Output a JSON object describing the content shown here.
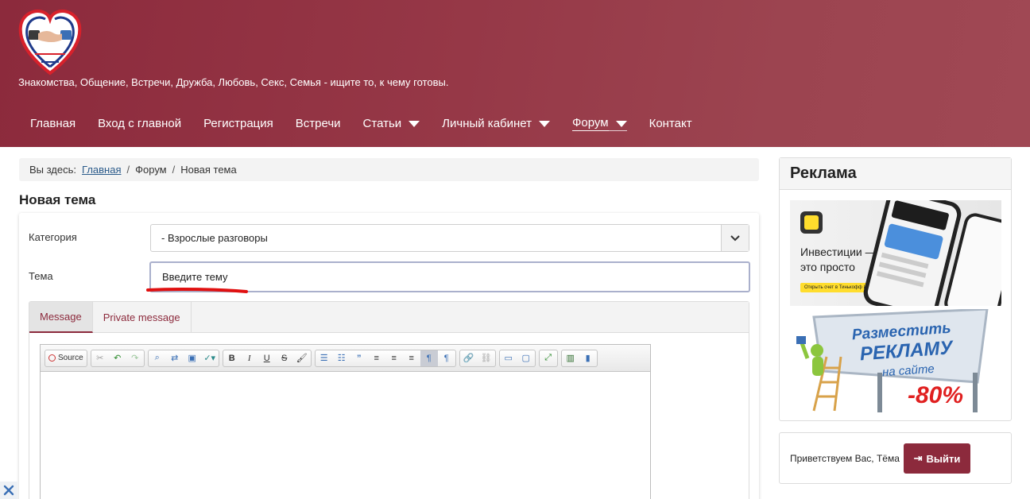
{
  "header": {
    "tagline": "Знакомства, Общение, Встречи, Дружба, Любовь, Секс, Семья - ищите то, к чему готовы."
  },
  "nav": [
    {
      "label": "Главная",
      "dropdown": false
    },
    {
      "label": "Вход с главной",
      "dropdown": false
    },
    {
      "label": "Регистрация",
      "dropdown": false
    },
    {
      "label": "Встречи",
      "dropdown": false
    },
    {
      "label": "Статьи",
      "dropdown": true
    },
    {
      "label": "Личный кабинет",
      "dropdown": true
    },
    {
      "label": "Форум",
      "dropdown": true,
      "active": true
    },
    {
      "label": "Контакт",
      "dropdown": false
    }
  ],
  "breadcrumb": {
    "prefix": "Вы здесь:",
    "home": "Главная",
    "forum": "Форум",
    "current": "Новая тема",
    "separator": "/"
  },
  "page_title": "Новая тема",
  "form": {
    "category_label": "Категория",
    "category_value": "- Взрослые разговоры",
    "topic_label": "Тема",
    "topic_placeholder": "Введите тему"
  },
  "tabs": [
    {
      "label": "Message",
      "active": true
    },
    {
      "label": "Private message",
      "active": false
    }
  ],
  "editor": {
    "source_label": "Source"
  },
  "sidebar": {
    "ad_title": "Реклама",
    "ad1_title_line1": "Инвестиции —",
    "ad1_title_line2": "это просто",
    "ad1_button": "Открыть счет в Тинькофф Инвестициях",
    "ad2_line1": "Разместить",
    "ad2_line2": "РЕКЛАМУ",
    "ad2_line3": "на сайте",
    "ad2_discount": "-80%"
  },
  "greeting": {
    "text": "Приветствуем Вас, Тёма",
    "logout_label": "Выйти"
  },
  "colors": {
    "brand": "#8c2a3c",
    "header_bg": "#963847",
    "link": "#2a5a8a"
  }
}
